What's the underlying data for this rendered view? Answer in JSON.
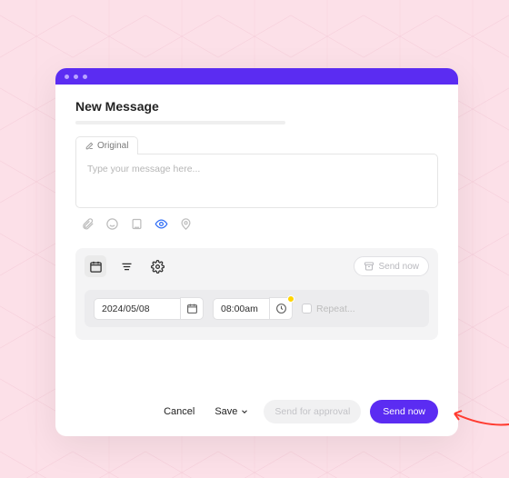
{
  "header": {
    "title": "New Message"
  },
  "tabs": {
    "original": "Original"
  },
  "composer": {
    "placeholder": "Type your message here..."
  },
  "icons": {
    "attach": "paperclip-icon",
    "emoji": "smile-icon",
    "doc": "sticker-icon",
    "preview": "eye-icon",
    "location": "pin-icon"
  },
  "schedule": {
    "tabs": {
      "calendar": "calendar-icon",
      "list": "list-icon",
      "settings": "gear-icon"
    },
    "send_now_small": "Send now",
    "date": "2024/05/08",
    "time": "08:00am",
    "repeat_label": "Repeat..."
  },
  "footer": {
    "cancel": "Cancel",
    "save": "Save",
    "approval": "Send for approval",
    "send_now": "Send now"
  },
  "colors": {
    "accent": "#5b2cf2",
    "bg": "#fce0e8",
    "panel": "#f4f4f5"
  }
}
